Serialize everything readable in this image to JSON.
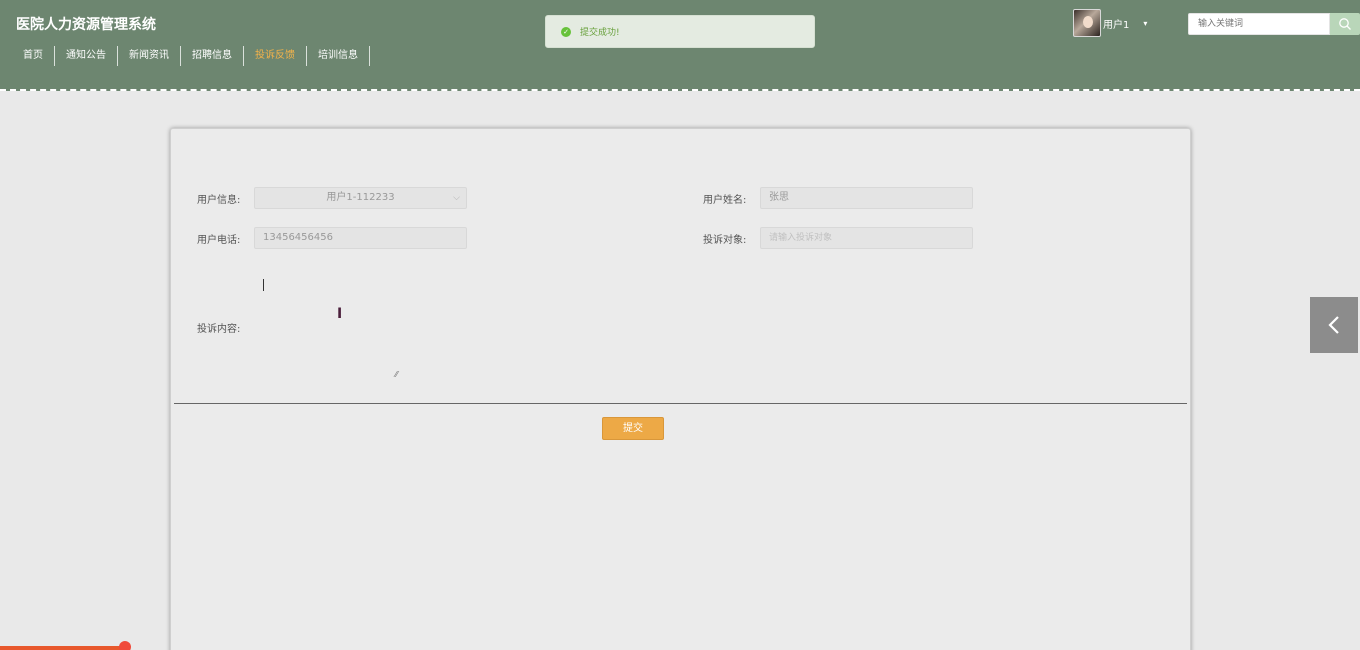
{
  "header": {
    "title": "医院人力资源管理系统",
    "nav": [
      "首页",
      "通知公告",
      "新闻资讯",
      "招聘信息",
      "投诉反馈",
      "培训信息"
    ],
    "active_nav": "投诉反馈",
    "accent_color": "#f2b24a",
    "header_color": "#6d8670"
  },
  "toast": {
    "icon": "check-circle-icon",
    "text": "提交成功!"
  },
  "user": {
    "name": "用户1",
    "caret": "▾"
  },
  "search": {
    "placeholder": "输入关键词",
    "icon": "search-icon"
  },
  "form": {
    "user_info_label": "用户信息:",
    "user_info_value": "用户1-112233",
    "user_name_label": "用户姓名:",
    "user_name_value": "张思",
    "phone_label": "用户电话:",
    "phone_value": "13456456456",
    "target_label": "投诉对象:",
    "target_placeholder": "请输入投诉对象",
    "content_label": "投诉内容:",
    "submit_label": "提交"
  },
  "side_toggle": {
    "icon": "chevron-left-icon"
  }
}
